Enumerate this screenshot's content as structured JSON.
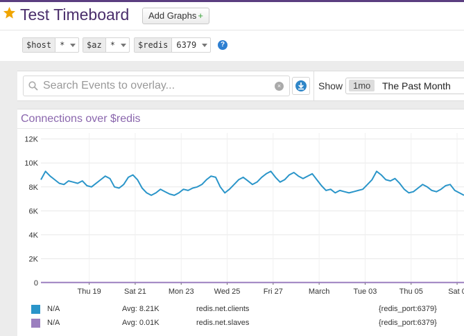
{
  "header": {
    "title": "Test Timeboard",
    "add_graphs_label": "Add Graphs",
    "add_graphs_plus": "+"
  },
  "template_vars": [
    {
      "name": "$host",
      "value": "*"
    },
    {
      "name": "$az",
      "value": "*"
    },
    {
      "name": "$redis",
      "value": "6379"
    }
  ],
  "help_icon_text": "?",
  "events": {
    "search_placeholder": "Search Events to overlay...",
    "clear_glyph": "×",
    "show_label": "Show",
    "range_badge": "1mo",
    "range_label": "The Past Month"
  },
  "graph": {
    "title": "Connections over $redis"
  },
  "chart_data": {
    "type": "line",
    "y_tick_labels": [
      "0",
      "2K",
      "4K",
      "6K",
      "8K",
      "10K",
      "12K"
    ],
    "y_tick_values": [
      0,
      2000,
      4000,
      6000,
      8000,
      10000,
      12000
    ],
    "ylim": [
      0,
      12500
    ],
    "x_tick_labels": [
      "Thu 19",
      "Sat 21",
      "Mon 23",
      "Wed 25",
      "Fri 27",
      "March",
      "Tue 03",
      "Thu 05",
      "Sat 0"
    ],
    "x_tick_positions": [
      8.9,
      10.9,
      12.9,
      14.9,
      16.9,
      18.9,
      20.9,
      22.9,
      24.9
    ],
    "xlim": [
      6.8,
      25.2
    ],
    "grid": true,
    "series": [
      {
        "name": "redis.net.clients",
        "color": "#2a95c9",
        "x": [
          6.8,
          7.0,
          7.2,
          7.4,
          7.6,
          7.8,
          8.0,
          8.2,
          8.4,
          8.6,
          8.8,
          9.0,
          9.2,
          9.4,
          9.6,
          9.8,
          10.0,
          10.2,
          10.4,
          10.6,
          10.8,
          11.0,
          11.2,
          11.4,
          11.6,
          11.8,
          12.0,
          12.2,
          12.4,
          12.6,
          12.8,
          13.0,
          13.2,
          13.4,
          13.6,
          13.8,
          14.0,
          14.2,
          14.4,
          14.6,
          14.8,
          15.0,
          15.2,
          15.4,
          15.6,
          15.8,
          16.0,
          16.2,
          16.4,
          16.6,
          16.8,
          17.0,
          17.2,
          17.4,
          17.6,
          17.8,
          18.0,
          18.2,
          18.4,
          18.6,
          18.8,
          19.0,
          19.2,
          19.4,
          19.6,
          19.8,
          20.0,
          20.2,
          20.4,
          20.6,
          20.8,
          21.0,
          21.2,
          21.4,
          21.6,
          21.8,
          22.0,
          22.2,
          22.4,
          22.6,
          22.8,
          23.0,
          23.2,
          23.4,
          23.6,
          23.8,
          24.0,
          24.2,
          24.4,
          24.6,
          24.8,
          25.0,
          25.2
        ],
        "values": [
          8600,
          9300,
          8900,
          8600,
          8300,
          8200,
          8500,
          8400,
          8300,
          8500,
          8100,
          8000,
          8300,
          8600,
          8900,
          8700,
          8000,
          7900,
          8200,
          8800,
          9000,
          8600,
          7900,
          7500,
          7300,
          7500,
          7800,
          7600,
          7400,
          7300,
          7500,
          7800,
          7700,
          7900,
          8000,
          8200,
          8600,
          8900,
          8800,
          8000,
          7500,
          7800,
          8200,
          8600,
          8800,
          8500,
          8200,
          8400,
          8800,
          9100,
          9300,
          8800,
          8400,
          8600,
          9000,
          9200,
          8900,
          8700,
          8900,
          9100,
          8600,
          8100,
          7700,
          7800,
          7500,
          7700,
          7600,
          7500,
          7600,
          7700,
          7800,
          8200,
          8600,
          9300,
          9000,
          8600,
          8500,
          8700,
          8300,
          7800,
          7500,
          7600,
          7900,
          8200,
          8000,
          7700,
          7600,
          7800,
          8100,
          8200,
          7700,
          7500,
          7300
        ]
      },
      {
        "name": "redis.net.slaves",
        "color": "#9b7fbf",
        "x": [
          6.8,
          25.2
        ],
        "values": [
          10,
          10
        ]
      }
    ]
  },
  "legend": [
    {
      "color": "#2a95c9",
      "name": "N/A",
      "avg": "Avg: 8.21K",
      "metric": "redis.net.clients",
      "tag": "{redis_port:6379}"
    },
    {
      "color": "#9b7fbf",
      "name": "N/A",
      "avg": "Avg: 0.01K",
      "metric": "redis.net.slaves",
      "tag": "{redis_port:6379}"
    }
  ]
}
